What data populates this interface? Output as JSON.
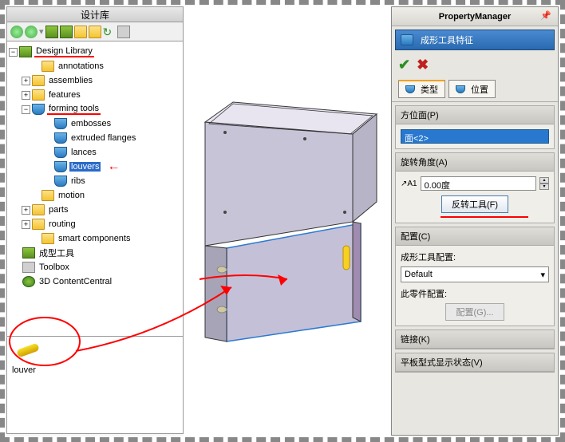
{
  "left": {
    "title": "设计库",
    "tree": {
      "root": "Design Library",
      "items": [
        "annotations",
        "assemblies",
        "features",
        "forming tools"
      ],
      "forming_children": [
        "embosses",
        "extruded flanges",
        "lances",
        "louvers",
        "ribs"
      ],
      "items2": [
        "motion",
        "parts",
        "routing",
        "smart components"
      ],
      "extras": [
        "成型工具",
        "Toolbox",
        "3D ContentCentral"
      ]
    },
    "preview_label": "louver"
  },
  "pm": {
    "title": "PropertyManager",
    "header": "成形工具特征",
    "tabs": {
      "type": "类型",
      "position": "位置"
    },
    "sections": {
      "placement": {
        "title": "方位面(P)",
        "value": "面<2>"
      },
      "angle": {
        "title": "旋转角度(A)",
        "value": "0.00度",
        "flip_btn": "反转工具(F)"
      },
      "config": {
        "title": "配置(C)",
        "label1": "成形工具配置:",
        "select": "Default",
        "label2": "此零件配置:",
        "btn": "配置(G)..."
      },
      "link": {
        "title": "链接(K)"
      },
      "flat": {
        "title": "平板型式显示状态(V)"
      }
    }
  }
}
